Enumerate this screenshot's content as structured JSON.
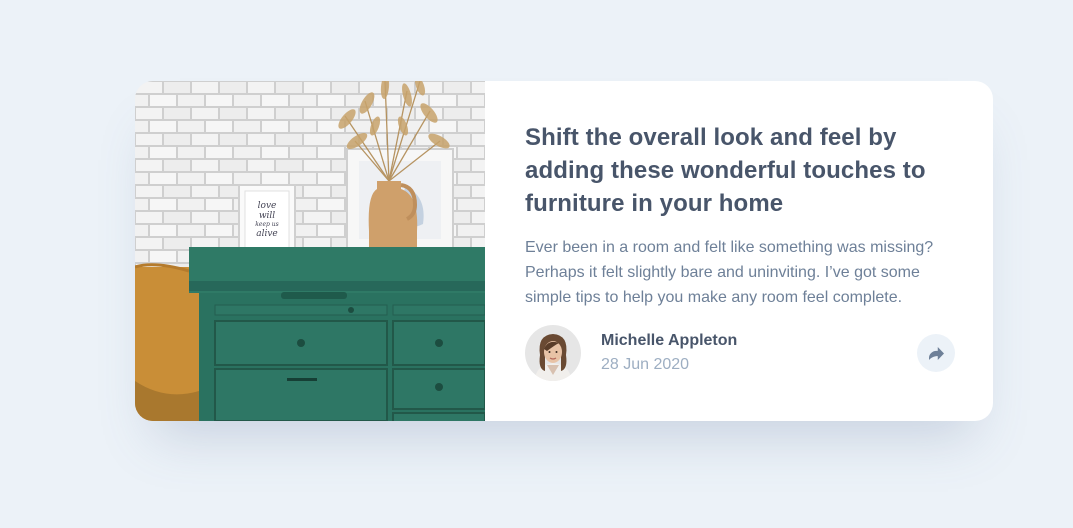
{
  "article": {
    "headline": "Shift the overall look and feel by adding these wonderful touches to furniture in your home",
    "excerpt": "Ever been in a room and felt like something was missing? Perhaps it felt slightly bare and uninviting. I’ve got some simple tips to help you make any room feel complete.",
    "image_frame_text": "love will keep us alive"
  },
  "author": {
    "name": "Michelle Appleton",
    "date": "28 Jun 2020"
  },
  "share": {
    "icon": "share-icon"
  },
  "colors": {
    "page_background": "#ECF2F8",
    "card_background": "#FFFFFF",
    "headline": "#48556A",
    "body_text": "#6E8098",
    "date_text": "#9DAEC2",
    "share_background": "#ECF2F8",
    "share_icon": "#6E8098",
    "drawer_green": "#2E7765"
  }
}
